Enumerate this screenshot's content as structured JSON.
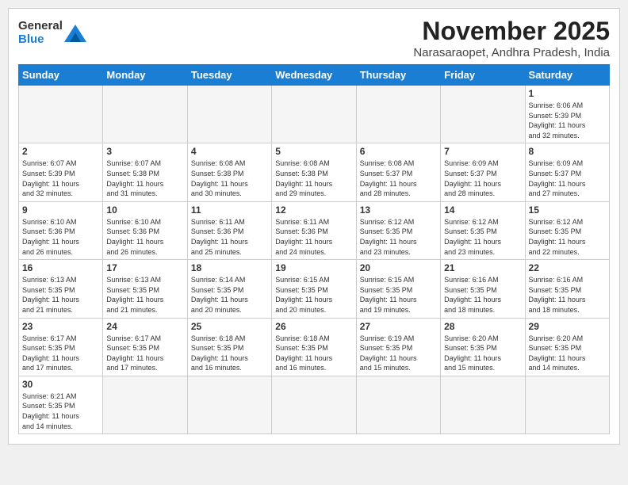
{
  "header": {
    "logo_general": "General",
    "logo_blue": "Blue",
    "month_title": "November 2025",
    "location": "Narasaraopet, Andhra Pradesh, India"
  },
  "weekdays": [
    "Sunday",
    "Monday",
    "Tuesday",
    "Wednesday",
    "Thursday",
    "Friday",
    "Saturday"
  ],
  "weeks": [
    [
      {
        "day": "",
        "info": ""
      },
      {
        "day": "",
        "info": ""
      },
      {
        "day": "",
        "info": ""
      },
      {
        "day": "",
        "info": ""
      },
      {
        "day": "",
        "info": ""
      },
      {
        "day": "",
        "info": ""
      },
      {
        "day": "1",
        "info": "Sunrise: 6:06 AM\nSunset: 5:39 PM\nDaylight: 11 hours\nand 32 minutes."
      }
    ],
    [
      {
        "day": "2",
        "info": "Sunrise: 6:07 AM\nSunset: 5:39 PM\nDaylight: 11 hours\nand 32 minutes."
      },
      {
        "day": "3",
        "info": "Sunrise: 6:07 AM\nSunset: 5:38 PM\nDaylight: 11 hours\nand 31 minutes."
      },
      {
        "day": "4",
        "info": "Sunrise: 6:08 AM\nSunset: 5:38 PM\nDaylight: 11 hours\nand 30 minutes."
      },
      {
        "day": "5",
        "info": "Sunrise: 6:08 AM\nSunset: 5:38 PM\nDaylight: 11 hours\nand 29 minutes."
      },
      {
        "day": "6",
        "info": "Sunrise: 6:08 AM\nSunset: 5:37 PM\nDaylight: 11 hours\nand 28 minutes."
      },
      {
        "day": "7",
        "info": "Sunrise: 6:09 AM\nSunset: 5:37 PM\nDaylight: 11 hours\nand 28 minutes."
      },
      {
        "day": "8",
        "info": "Sunrise: 6:09 AM\nSunset: 5:37 PM\nDaylight: 11 hours\nand 27 minutes."
      }
    ],
    [
      {
        "day": "9",
        "info": "Sunrise: 6:10 AM\nSunset: 5:36 PM\nDaylight: 11 hours\nand 26 minutes."
      },
      {
        "day": "10",
        "info": "Sunrise: 6:10 AM\nSunset: 5:36 PM\nDaylight: 11 hours\nand 26 minutes."
      },
      {
        "day": "11",
        "info": "Sunrise: 6:11 AM\nSunset: 5:36 PM\nDaylight: 11 hours\nand 25 minutes."
      },
      {
        "day": "12",
        "info": "Sunrise: 6:11 AM\nSunset: 5:36 PM\nDaylight: 11 hours\nand 24 minutes."
      },
      {
        "day": "13",
        "info": "Sunrise: 6:12 AM\nSunset: 5:35 PM\nDaylight: 11 hours\nand 23 minutes."
      },
      {
        "day": "14",
        "info": "Sunrise: 6:12 AM\nSunset: 5:35 PM\nDaylight: 11 hours\nand 23 minutes."
      },
      {
        "day": "15",
        "info": "Sunrise: 6:12 AM\nSunset: 5:35 PM\nDaylight: 11 hours\nand 22 minutes."
      }
    ],
    [
      {
        "day": "16",
        "info": "Sunrise: 6:13 AM\nSunset: 5:35 PM\nDaylight: 11 hours\nand 21 minutes."
      },
      {
        "day": "17",
        "info": "Sunrise: 6:13 AM\nSunset: 5:35 PM\nDaylight: 11 hours\nand 21 minutes."
      },
      {
        "day": "18",
        "info": "Sunrise: 6:14 AM\nSunset: 5:35 PM\nDaylight: 11 hours\nand 20 minutes."
      },
      {
        "day": "19",
        "info": "Sunrise: 6:15 AM\nSunset: 5:35 PM\nDaylight: 11 hours\nand 20 minutes."
      },
      {
        "day": "20",
        "info": "Sunrise: 6:15 AM\nSunset: 5:35 PM\nDaylight: 11 hours\nand 19 minutes."
      },
      {
        "day": "21",
        "info": "Sunrise: 6:16 AM\nSunset: 5:35 PM\nDaylight: 11 hours\nand 18 minutes."
      },
      {
        "day": "22",
        "info": "Sunrise: 6:16 AM\nSunset: 5:35 PM\nDaylight: 11 hours\nand 18 minutes."
      }
    ],
    [
      {
        "day": "23",
        "info": "Sunrise: 6:17 AM\nSunset: 5:35 PM\nDaylight: 11 hours\nand 17 minutes."
      },
      {
        "day": "24",
        "info": "Sunrise: 6:17 AM\nSunset: 5:35 PM\nDaylight: 11 hours\nand 17 minutes."
      },
      {
        "day": "25",
        "info": "Sunrise: 6:18 AM\nSunset: 5:35 PM\nDaylight: 11 hours\nand 16 minutes."
      },
      {
        "day": "26",
        "info": "Sunrise: 6:18 AM\nSunset: 5:35 PM\nDaylight: 11 hours\nand 16 minutes."
      },
      {
        "day": "27",
        "info": "Sunrise: 6:19 AM\nSunset: 5:35 PM\nDaylight: 11 hours\nand 15 minutes."
      },
      {
        "day": "28",
        "info": "Sunrise: 6:20 AM\nSunset: 5:35 PM\nDaylight: 11 hours\nand 15 minutes."
      },
      {
        "day": "29",
        "info": "Sunrise: 6:20 AM\nSunset: 5:35 PM\nDaylight: 11 hours\nand 14 minutes."
      }
    ],
    [
      {
        "day": "30",
        "info": "Sunrise: 6:21 AM\nSunset: 5:35 PM\nDaylight: 11 hours\nand 14 minutes."
      },
      {
        "day": "",
        "info": ""
      },
      {
        "day": "",
        "info": ""
      },
      {
        "day": "",
        "info": ""
      },
      {
        "day": "",
        "info": ""
      },
      {
        "day": "",
        "info": ""
      },
      {
        "day": "",
        "info": ""
      }
    ]
  ]
}
